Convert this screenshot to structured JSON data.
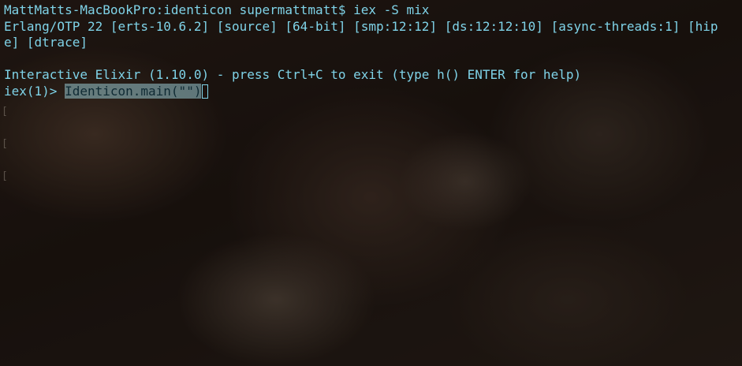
{
  "terminal": {
    "prompt_line": "MattMatts-MacBookPro:identicon supermattmatt$ iex -S mix",
    "erlang_line_1": "Erlang/OTP 22 [erts-10.6.2] [source] [64-bit] [smp:12:12] [ds:12:12:10] [async-threads:1] [hip",
    "erlang_line_2": "e] [dtrace]",
    "elixir_banner": "Interactive Elixir (1.10.0) - press Ctrl+C to exit (type h() ENTER for help)",
    "iex_prompt": "iex(1)> ",
    "iex_command": "Identicon.main(\"\")",
    "marks": [
      "[",
      "[",
      "["
    ]
  },
  "colors": {
    "text": "#7fd3e8",
    "selection": "#98c8d2"
  }
}
